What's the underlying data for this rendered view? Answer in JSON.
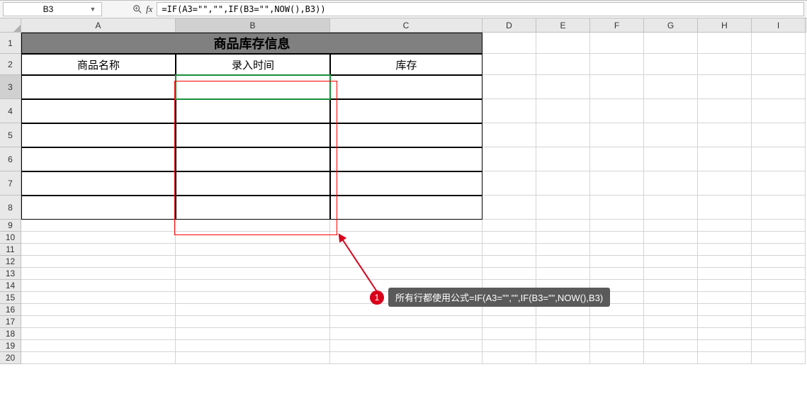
{
  "name_box": {
    "value": "B3"
  },
  "formula_bar": {
    "value": "=IF(A3=\"\",\"\",IF(B3=\"\",NOW(),B3))"
  },
  "columns": [
    "A",
    "B",
    "C",
    "D",
    "E",
    "F",
    "G",
    "H",
    "I"
  ],
  "active_column_index": 1,
  "active_row_index": 2,
  "title": "商品库存信息",
  "headers": {
    "a": "商品名称",
    "b": "录入时间",
    "c": "库存"
  },
  "data_row_count": 6,
  "extra_row_start": 9,
  "extra_row_end": 20,
  "annotation": {
    "number": "1",
    "text": "所有行都使用公式=IF(A3=\"\",\"\",IF(B3=\"\",NOW(),B3)"
  },
  "colors": {
    "active_outline": "#1a8f3c",
    "highlight_box": "#ff0000",
    "callout_bg": "#5a5a5a",
    "callout_badge": "#d9001b",
    "title_bg": "#808080"
  }
}
